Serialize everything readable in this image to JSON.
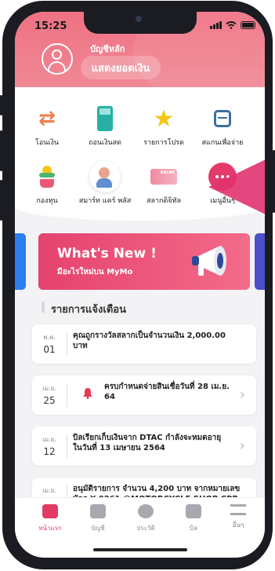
{
  "status": {
    "time": "15:25"
  },
  "header": {
    "account_name": "บัญชีหลัก",
    "show_balance_label": "แสดงยอดเงิน"
  },
  "menu": {
    "items": [
      {
        "label": "โอนเงิน",
        "icon": "transfer-icon"
      },
      {
        "label": "ถอนเงินสด",
        "icon": "atm-icon"
      },
      {
        "label": "รายการโปรด",
        "icon": "star-icon"
      },
      {
        "label": "สแกนเพื่อจ่าย",
        "icon": "scan-icon"
      },
      {
        "label": "กองทุน",
        "icon": "fund-icon"
      },
      {
        "label": "สมาร์ท แคร์ พลัส",
        "icon": "care-icon"
      },
      {
        "label": "สลากดิจิทัล",
        "icon": "lottery-icon"
      },
      {
        "label": "เมนูอื่นๆ",
        "icon": "more-icon"
      }
    ]
  },
  "banner": {
    "title": "What's New !",
    "subtitle": "มีอะไรใหม่บน MyMo"
  },
  "notifications": {
    "title": "รายการแจ้งเตือน",
    "items": [
      {
        "month": "พ.ค.",
        "day": "01",
        "text": "คุณถูกรางวัลสลากเป็นจำนวนเงิน 2,000.00 บาท"
      },
      {
        "month": "เม.ย.",
        "day": "25",
        "text": "ครบกำหนดจ่ายสินเชื่อวันที่ 28 เม.ย. 64"
      },
      {
        "month": "เม.ย.",
        "day": "12",
        "text": "บิลเรียกเก็บเงินจาก DTAC กำลังจะหมดอายุในวันที่ 13 เมษายน 2564"
      },
      {
        "month": "เม.ย.",
        "day": "10",
        "text": "อนุมัติรายการ จำนวน 4,200 บาท จากหมายเลขบัตร X-0261 @MOTORCYCLE SHOP CPR RA"
      }
    ]
  },
  "tabbar": {
    "items": [
      {
        "label": "หน้าแรก",
        "icon": "home-icon",
        "active": true
      },
      {
        "label": "บัญชี",
        "icon": "wallet-icon",
        "active": false
      },
      {
        "label": "ประวัติ",
        "icon": "history-icon",
        "active": false
      },
      {
        "label": "บิล",
        "icon": "bill-icon",
        "active": false
      },
      {
        "label": "อื่นๆ",
        "icon": "menu-icon",
        "active": false
      }
    ]
  },
  "colors": {
    "brand": "#e23b63",
    "header_top": "#ef7182"
  }
}
